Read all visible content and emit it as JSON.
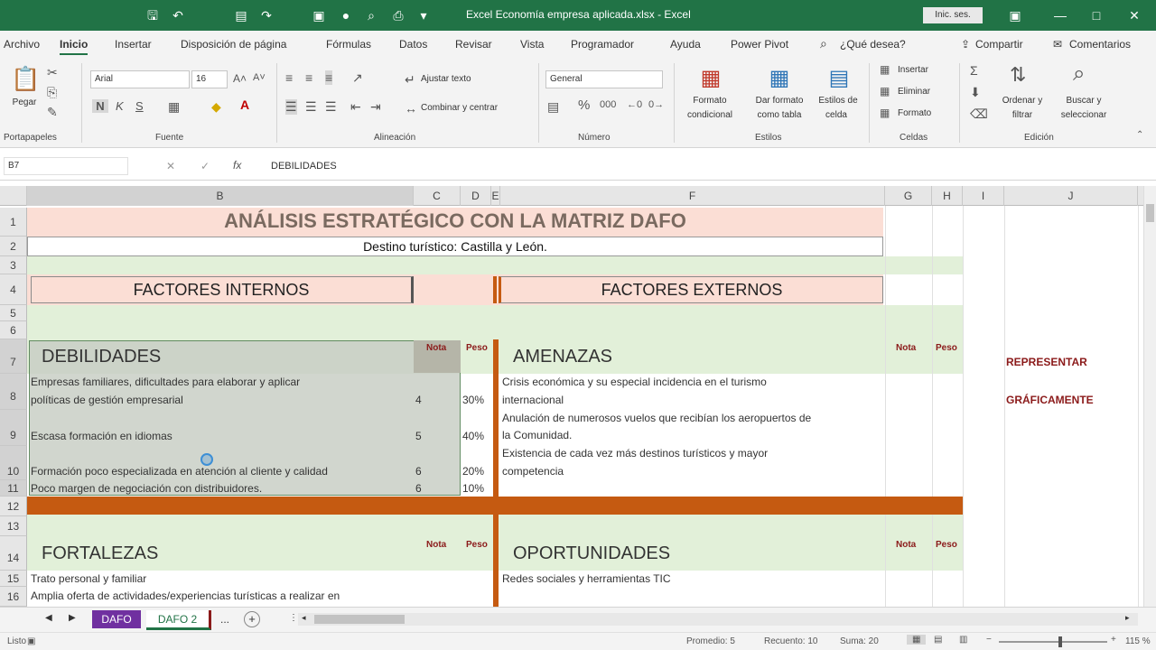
{
  "titlebar": {
    "title": "Excel Economía empresa aplicada.xlsx - Excel",
    "signin": "Inic. ses."
  },
  "tabs": [
    "Archivo",
    "Inicio",
    "Insertar",
    "Disposición de página",
    "Fórmulas",
    "Datos",
    "Revisar",
    "Vista",
    "Programador",
    "Ayuda",
    "Power Pivot",
    "¿Qué desea?"
  ],
  "share": "Compartir",
  "comments": "Comentarios",
  "ribbon": {
    "paste": "Pegar",
    "clipboard": "Portapapeles",
    "font_name": "Arial",
    "font_size": "16",
    "bold": "N",
    "italic": "K",
    "underline": "S",
    "font_group": "Fuente",
    "wrap_text": "Ajustar texto",
    "merge_center": "Combinar y centrar",
    "alignment": "Alineación",
    "number_format": "General",
    "number_group": "Número",
    "cond_format_1": "Formato",
    "cond_format_2": "condicional",
    "format_table_1": "Dar formato",
    "format_table_2": "como tabla",
    "cell_styles_1": "Estilos de",
    "cell_styles_2": "celda",
    "styles_group": "Estilos",
    "insert": "Insertar",
    "delete": "Eliminar",
    "format": "Formato",
    "cells_group": "Celdas",
    "sort_1": "Ordenar y",
    "sort_2": "filtrar",
    "find_1": "Buscar y",
    "find_2": "seleccionar",
    "editing_group": "Edición"
  },
  "formula_bar": {
    "name_box": "B7",
    "fx": "fx",
    "formula": "DEBILIDADES"
  },
  "columns": [
    "B",
    "C",
    "D",
    "E",
    "F",
    "G",
    "H",
    "I",
    "J"
  ],
  "rows": [
    "1",
    "2",
    "3",
    "4",
    "5",
    "6",
    "7",
    "8",
    "9",
    "10",
    "11",
    "12",
    "13",
    "14",
    "15",
    "16"
  ],
  "sheet": {
    "title": "ANÁLISIS ESTRATÉGICO CON LA MATRIZ DAFO",
    "subtitle": "Destino turístico: Castilla y León.",
    "internal": "FACTORES INTERNOS",
    "external": "FACTORES EXTERNOS",
    "nota": "Nota",
    "peso": "Peso",
    "weaknesses_title": "DEBILIDADES",
    "threats_title": "AMENAZAS",
    "strengths_title": "FORTALEZAS",
    "opportunities_title": "OPORTUNIDADES",
    "represent_1": "REPRESENTAR",
    "represent_2": "GRÁFICAMENTE",
    "weaknesses": [
      {
        "line1": "Empresas familiares, dificultades para elaborar y aplicar",
        "line2": "políticas de gestión empresarial",
        "nota": "4",
        "peso": "30%"
      },
      {
        "line1": "Escasa formación en idiomas",
        "line2": "",
        "nota": "5",
        "peso": "40%"
      },
      {
        "line1": "Formación poco especializada en atención al cliente y calidad",
        "line2": "",
        "nota": "6",
        "peso": "20%"
      },
      {
        "line1": "Poco margen de negociación con distribuidores.",
        "line2": "",
        "nota": "6",
        "peso": "10%"
      }
    ],
    "threats": [
      {
        "line1": "Crisis económica y su especial incidencia en el turismo",
        "line2": "internacional"
      },
      {
        "line1": "Anulación de numerosos vuelos que recibían los aeropuertos de",
        "line2": "la Comunidad."
      },
      {
        "line1": "Existencia de cada vez más destinos turísticos y mayor",
        "line2": "competencia"
      }
    ],
    "strengths": [
      "Trato personal y familiar",
      "Amplia oferta de actividades/experiencias turísticas a realizar en"
    ],
    "opportunities": [
      "Redes sociales y herramientas TIC"
    ]
  },
  "sheet_tabs": {
    "tab1": "DAFO",
    "tab2": "DAFO 2",
    "more": "..."
  },
  "status": {
    "ready": "Listo",
    "average": "Promedio: 5",
    "count": "Recuento: 10",
    "sum": "Suma: 20",
    "zoom": "115 %"
  },
  "colors": {
    "excel_green": "#217346",
    "salmon": "#fbded5",
    "light_green": "#e2f0d9",
    "orange": "#c55a11",
    "dark_red": "#8b1a1a",
    "purple_tab": "#7030a0"
  }
}
